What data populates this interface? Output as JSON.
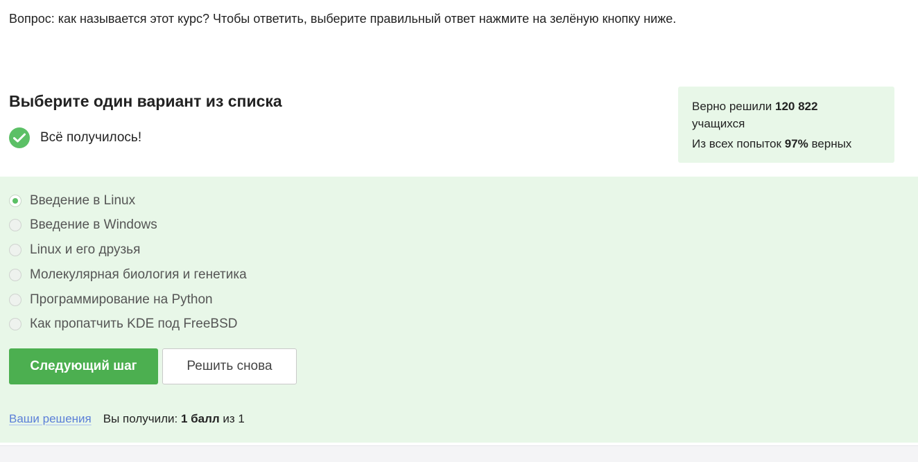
{
  "question": {
    "text": "Вопрос: как называется этот курс? Чтобы ответить, выберите правильный ответ нажмите на зелёную кнопку ниже."
  },
  "quiz": {
    "title": "Выберите один вариант из списка",
    "feedback": "Всё получилось!"
  },
  "stats": {
    "line1_prefix": "Верно решили ",
    "solved_count": "120 822",
    "line1_suffix": "учащихся",
    "line2_prefix": "Из всех попыток ",
    "percent": "97%",
    "line2_suffix": " верных"
  },
  "options": [
    {
      "label": "Введение в Linux",
      "selected": true
    },
    {
      "label": "Введение в Windows",
      "selected": false
    },
    {
      "label": "Linux и его друзья",
      "selected": false
    },
    {
      "label": "Молекулярная биология и генетика",
      "selected": false
    },
    {
      "label": "Программирование на Python",
      "selected": false
    },
    {
      "label": "Как пропатчить KDE под FreeBSD",
      "selected": false
    }
  ],
  "buttons": {
    "next": "Следующий шаг",
    "retry": "Решить снова"
  },
  "footer": {
    "solutions_link": "Ваши решения",
    "score_prefix": "Вы получили: ",
    "score_value": "1 балл",
    "score_suffix": " из 1"
  },
  "colors": {
    "accent_green": "#4caf50",
    "success_bg": "#e8f7e8",
    "link_blue": "#5b7fd8"
  },
  "icons": {
    "feedback": "checkmark-icon"
  }
}
